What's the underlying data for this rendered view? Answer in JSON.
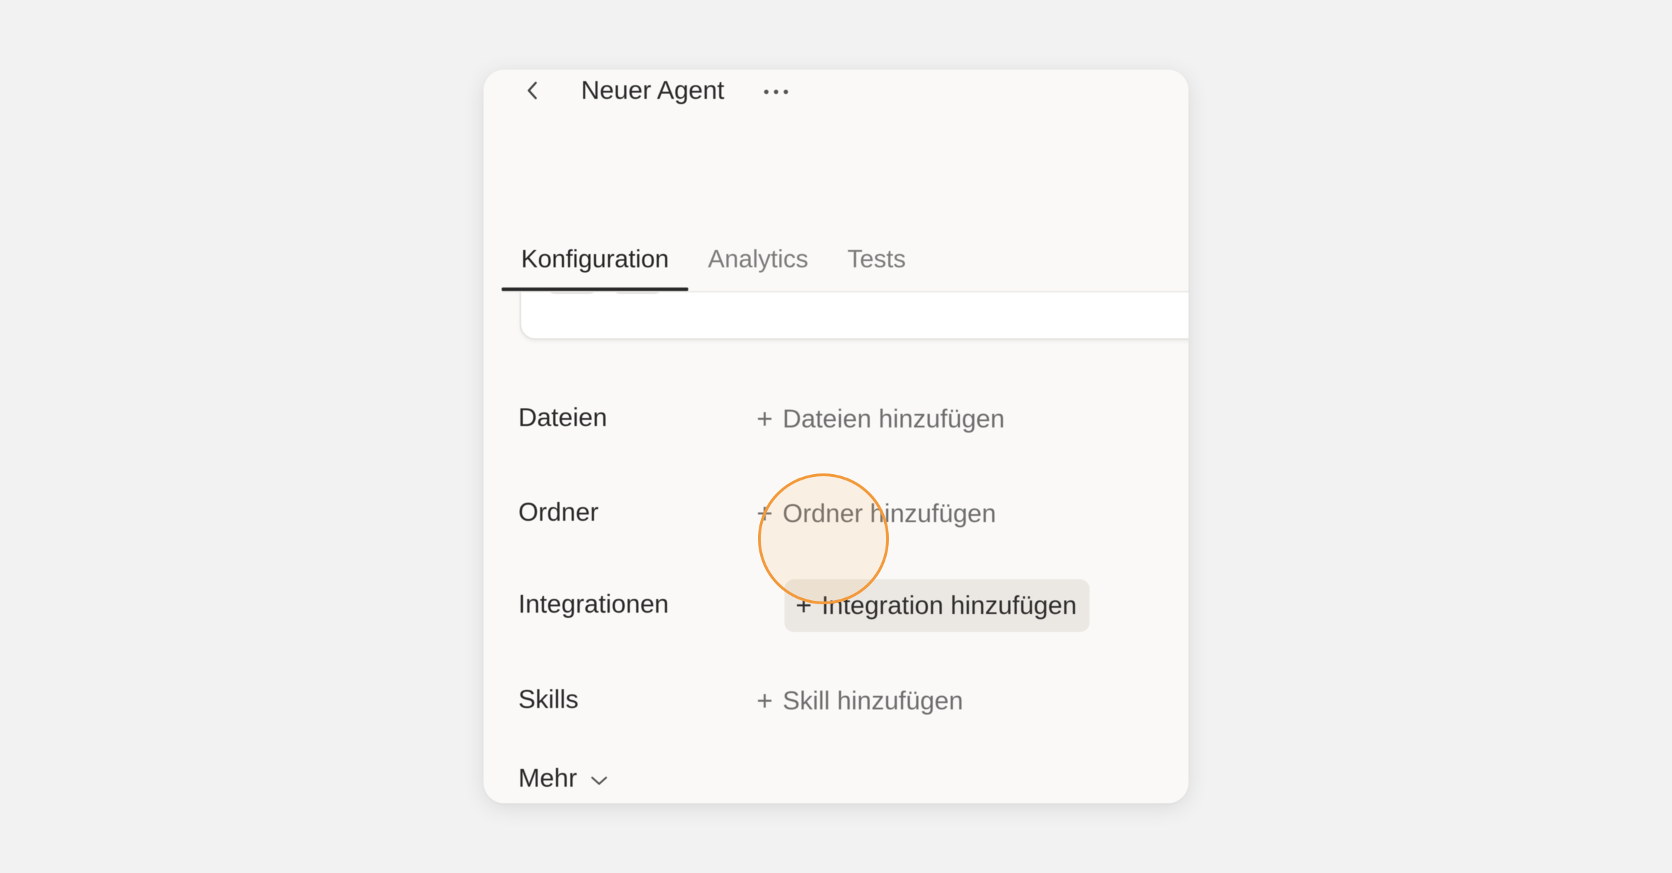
{
  "header": {
    "title": "Neuer Agent",
    "back_icon": "chevron-left-icon",
    "more_icon": "more-horizontal-icon"
  },
  "tabs": [
    {
      "label": "Konfiguration",
      "active": true
    },
    {
      "label": "Analytics",
      "active": false
    },
    {
      "label": "Tests",
      "active": false
    }
  ],
  "sections": {
    "files": {
      "label": "Dateien",
      "action": "Dateien hinzufügen"
    },
    "folders": {
      "label": "Ordner",
      "action": "Ordner hinzufügen"
    },
    "integrations": {
      "label": "Integrationen",
      "action": "Integration hinzufügen"
    },
    "skills": {
      "label": "Skills",
      "action": "Skill hinzufügen"
    }
  },
  "more": {
    "label": "Mehr",
    "icon": "chevron-down-icon"
  },
  "plus_glyph": "+",
  "colors": {
    "accent_click": "#f39a3c",
    "panel_bg": "#faf9f7",
    "hover_bg": "#ebe8e3"
  }
}
